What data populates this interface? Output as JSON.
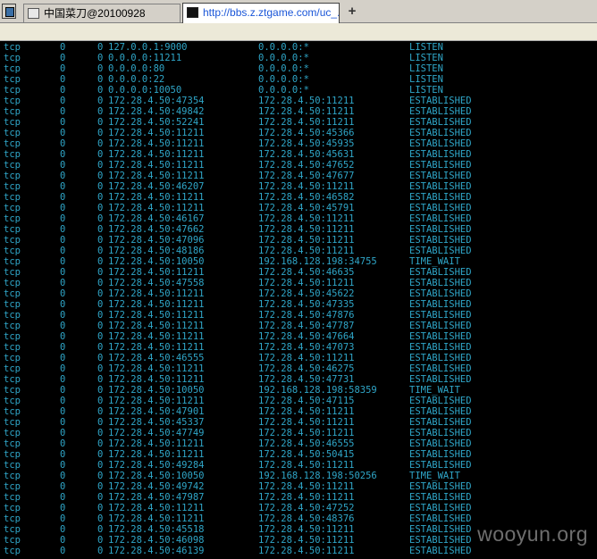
{
  "tabs": [
    {
      "label": "中国菜刀@20100928",
      "active": false
    },
    {
      "label": "http://bbs.z.ztgame.com/uc_...",
      "active": true
    }
  ],
  "new_tab_label": "+",
  "watermark": "wooyun.org",
  "colors": {
    "terminal_bg": "#000000",
    "terminal_text": "#2fa6c8"
  },
  "rows": [
    {
      "proto": "tcp",
      "recv": "0",
      "send": "0",
      "local": "127.0.0.1:9000",
      "foreign": "0.0.0.0:*",
      "state": "LISTEN"
    },
    {
      "proto": "tcp",
      "recv": "0",
      "send": "0",
      "local": "0.0.0.0:11211",
      "foreign": "0.0.0.0:*",
      "state": "LISTEN"
    },
    {
      "proto": "tcp",
      "recv": "0",
      "send": "0",
      "local": "0.0.0.0:80",
      "foreign": "0.0.0.0:*",
      "state": "LISTEN"
    },
    {
      "proto": "tcp",
      "recv": "0",
      "send": "0",
      "local": "0.0.0.0:22",
      "foreign": "0.0.0.0:*",
      "state": "LISTEN"
    },
    {
      "proto": "tcp",
      "recv": "0",
      "send": "0",
      "local": "0.0.0.0:10050",
      "foreign": "0.0.0.0:*",
      "state": "LISTEN"
    },
    {
      "proto": "tcp",
      "recv": "0",
      "send": "0",
      "local": "172.28.4.50:47354",
      "foreign": "172.28.4.50:11211",
      "state": "ESTABLISHED"
    },
    {
      "proto": "tcp",
      "recv": "0",
      "send": "0",
      "local": "172.28.4.50:49842",
      "foreign": "172.28.4.50:11211",
      "state": "ESTABLISHED"
    },
    {
      "proto": "tcp",
      "recv": "0",
      "send": "0",
      "local": "172.28.4.50:52241",
      "foreign": "172.28.4.50:11211",
      "state": "ESTABLISHED"
    },
    {
      "proto": "tcp",
      "recv": "0",
      "send": "0",
      "local": "172.28.4.50:11211",
      "foreign": "172.28.4.50:45366",
      "state": "ESTABLISHED"
    },
    {
      "proto": "tcp",
      "recv": "0",
      "send": "0",
      "local": "172.28.4.50:11211",
      "foreign": "172.28.4.50:45935",
      "state": "ESTABLISHED"
    },
    {
      "proto": "tcp",
      "recv": "0",
      "send": "0",
      "local": "172.28.4.50:11211",
      "foreign": "172.28.4.50:45631",
      "state": "ESTABLISHED"
    },
    {
      "proto": "tcp",
      "recv": "0",
      "send": "0",
      "local": "172.28.4.50:11211",
      "foreign": "172.28.4.50:47652",
      "state": "ESTABLISHED"
    },
    {
      "proto": "tcp",
      "recv": "0",
      "send": "0",
      "local": "172.28.4.50:11211",
      "foreign": "172.28.4.50:47677",
      "state": "ESTABLISHED"
    },
    {
      "proto": "tcp",
      "recv": "0",
      "send": "0",
      "local": "172.28.4.50:46207",
      "foreign": "172.28.4.50:11211",
      "state": "ESTABLISHED"
    },
    {
      "proto": "tcp",
      "recv": "0",
      "send": "0",
      "local": "172.28.4.50:11211",
      "foreign": "172.28.4.50:46582",
      "state": "ESTABLISHED"
    },
    {
      "proto": "tcp",
      "recv": "0",
      "send": "0",
      "local": "172.28.4.50:11211",
      "foreign": "172.28.4.50:45791",
      "state": "ESTABLISHED"
    },
    {
      "proto": "tcp",
      "recv": "0",
      "send": "0",
      "local": "172.28.4.50:46167",
      "foreign": "172.28.4.50:11211",
      "state": "ESTABLISHED"
    },
    {
      "proto": "tcp",
      "recv": "0",
      "send": "0",
      "local": "172.28.4.50:47662",
      "foreign": "172.28.4.50:11211",
      "state": "ESTABLISHED"
    },
    {
      "proto": "tcp",
      "recv": "0",
      "send": "0",
      "local": "172.28.4.50:47096",
      "foreign": "172.28.4.50:11211",
      "state": "ESTABLISHED"
    },
    {
      "proto": "tcp",
      "recv": "0",
      "send": "0",
      "local": "172.28.4.50:48186",
      "foreign": "172.28.4.50:11211",
      "state": "ESTABLISHED"
    },
    {
      "proto": "tcp",
      "recv": "0",
      "send": "0",
      "local": "172.28.4.50:10050",
      "foreign": "192.168.128.198:34755",
      "state": "TIME_WAIT"
    },
    {
      "proto": "tcp",
      "recv": "0",
      "send": "0",
      "local": "172.28.4.50:11211",
      "foreign": "172.28.4.50:46635",
      "state": "ESTABLISHED"
    },
    {
      "proto": "tcp",
      "recv": "0",
      "send": "0",
      "local": "172.28.4.50:47558",
      "foreign": "172.28.4.50:11211",
      "state": "ESTABLISHED"
    },
    {
      "proto": "tcp",
      "recv": "0",
      "send": "0",
      "local": "172.28.4.50:11211",
      "foreign": "172.28.4.50:45622",
      "state": "ESTABLISHED"
    },
    {
      "proto": "tcp",
      "recv": "0",
      "send": "0",
      "local": "172.28.4.50:11211",
      "foreign": "172.28.4.50:47335",
      "state": "ESTABLISHED"
    },
    {
      "proto": "tcp",
      "recv": "0",
      "send": "0",
      "local": "172.28.4.50:11211",
      "foreign": "172.28.4.50:47876",
      "state": "ESTABLISHED"
    },
    {
      "proto": "tcp",
      "recv": "0",
      "send": "0",
      "local": "172.28.4.50:11211",
      "foreign": "172.28.4.50:47787",
      "state": "ESTABLISHED"
    },
    {
      "proto": "tcp",
      "recv": "0",
      "send": "0",
      "local": "172.28.4.50:11211",
      "foreign": "172.28.4.50:47664",
      "state": "ESTABLISHED"
    },
    {
      "proto": "tcp",
      "recv": "0",
      "send": "0",
      "local": "172.28.4.50:11211",
      "foreign": "172.28.4.50:47073",
      "state": "ESTABLISHED"
    },
    {
      "proto": "tcp",
      "recv": "0",
      "send": "0",
      "local": "172.28.4.50:46555",
      "foreign": "172.28.4.50:11211",
      "state": "ESTABLISHED"
    },
    {
      "proto": "tcp",
      "recv": "0",
      "send": "0",
      "local": "172.28.4.50:11211",
      "foreign": "172.28.4.50:46275",
      "state": "ESTABLISHED"
    },
    {
      "proto": "tcp",
      "recv": "0",
      "send": "0",
      "local": "172.28.4.50:11211",
      "foreign": "172.28.4.50:47731",
      "state": "ESTABLISHED"
    },
    {
      "proto": "tcp",
      "recv": "0",
      "send": "0",
      "local": "172.28.4.50:10050",
      "foreign": "192.168.128.198:58359",
      "state": "TIME_WAIT"
    },
    {
      "proto": "tcp",
      "recv": "0",
      "send": "0",
      "local": "172.28.4.50:11211",
      "foreign": "172.28.4.50:47115",
      "state": "ESTABLISHED"
    },
    {
      "proto": "tcp",
      "recv": "0",
      "send": "0",
      "local": "172.28.4.50:47901",
      "foreign": "172.28.4.50:11211",
      "state": "ESTABLISHED"
    },
    {
      "proto": "tcp",
      "recv": "0",
      "send": "0",
      "local": "172.28.4.50:45337",
      "foreign": "172.28.4.50:11211",
      "state": "ESTABLISHED"
    },
    {
      "proto": "tcp",
      "recv": "0",
      "send": "0",
      "local": "172.28.4.50:47749",
      "foreign": "172.28.4.50:11211",
      "state": "ESTABLISHED"
    },
    {
      "proto": "tcp",
      "recv": "0",
      "send": "0",
      "local": "172.28.4.50:11211",
      "foreign": "172.28.4.50:46555",
      "state": "ESTABLISHED"
    },
    {
      "proto": "tcp",
      "recv": "0",
      "send": "0",
      "local": "172.28.4.50:11211",
      "foreign": "172.28.4.50:50415",
      "state": "ESTABLISHED"
    },
    {
      "proto": "tcp",
      "recv": "0",
      "send": "0",
      "local": "172.28.4.50:49284",
      "foreign": "172.28.4.50:11211",
      "state": "ESTABLISHED"
    },
    {
      "proto": "tcp",
      "recv": "0",
      "send": "0",
      "local": "172.28.4.50:10050",
      "foreign": "192.168.128.198:50256",
      "state": "TIME_WAIT"
    },
    {
      "proto": "tcp",
      "recv": "0",
      "send": "0",
      "local": "172.28.4.50:49742",
      "foreign": "172.28.4.50:11211",
      "state": "ESTABLISHED"
    },
    {
      "proto": "tcp",
      "recv": "0",
      "send": "0",
      "local": "172.28.4.50:47987",
      "foreign": "172.28.4.50:11211",
      "state": "ESTABLISHED"
    },
    {
      "proto": "tcp",
      "recv": "0",
      "send": "0",
      "local": "172.28.4.50:11211",
      "foreign": "172.28.4.50:47252",
      "state": "ESTABLISHED"
    },
    {
      "proto": "tcp",
      "recv": "0",
      "send": "0",
      "local": "172.28.4.50:11211",
      "foreign": "172.28.4.50:48376",
      "state": "ESTABLISHED"
    },
    {
      "proto": "tcp",
      "recv": "0",
      "send": "0",
      "local": "172.28.4.50:45518",
      "foreign": "172.28.4.50:11211",
      "state": "ESTABLISHED"
    },
    {
      "proto": "tcp",
      "recv": "0",
      "send": "0",
      "local": "172.28.4.50:46098",
      "foreign": "172.28.4.50:11211",
      "state": "ESTABLISHED"
    },
    {
      "proto": "tcp",
      "recv": "0",
      "send": "0",
      "local": "172.28.4.50:46139",
      "foreign": "172.28.4.50:11211",
      "state": "ESTABLISHED"
    }
  ]
}
